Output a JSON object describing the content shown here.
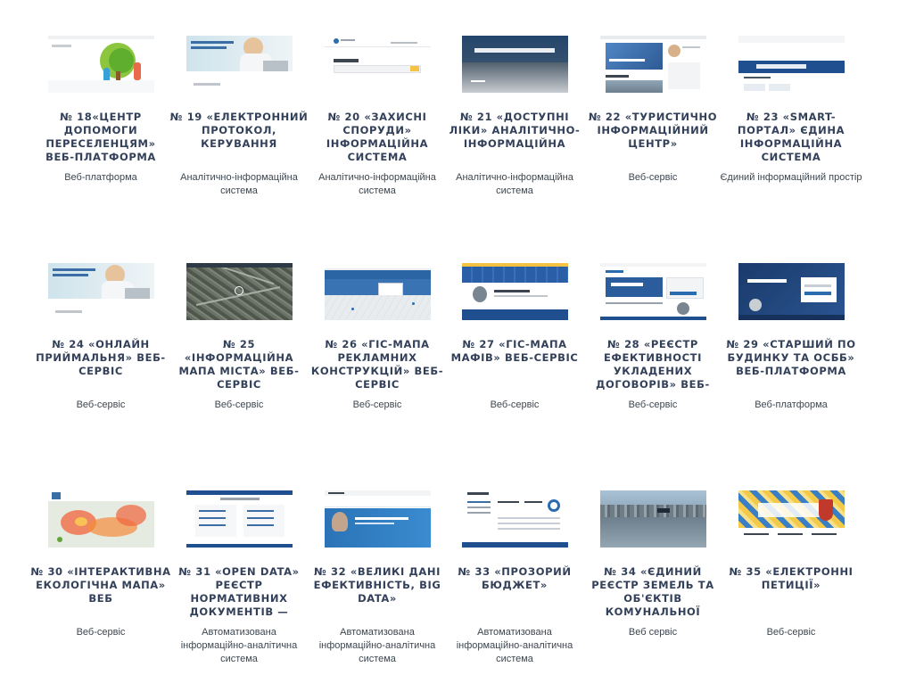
{
  "cards": [
    {
      "title": "№ 18«ЦЕНТР ДОПОМОГИ ПЕРЕСЕЛЕНЦЯМ» ВЕБ-ПЛАТФОРМА",
      "subtitle": "Веб-платформа",
      "thumb": "tree-illustration"
    },
    {
      "title": "№ 19 «ЕЛЕКТРОННИЙ ПРОТОКОЛ, КЕРУВАННЯ",
      "subtitle": "Аналітично-інформаційна система",
      "thumb": "woman-laptop"
    },
    {
      "title": "№ 20 «ЗАХИСНІ СПОРУДИ» ІНФОРМАЦІЙНА СИСТЕМА",
      "subtitle": "Аналітично-інформаційна система",
      "thumb": "search-form"
    },
    {
      "title": "№ 21 «ДОСТУПНІ ЛІКИ» АНАЛІТИЧНО-ІНФОРМАЦІЙНА",
      "subtitle": "Аналітично-інформаційна система",
      "thumb": "dark-banner"
    },
    {
      "title": "№ 22 «ТУРИСТИЧНО ІНФОРМАЦІЙНИЙ ЦЕНТР»",
      "subtitle": "Веб-сервіс",
      "thumb": "tourism-site"
    },
    {
      "title": "№ 23 «SMART-ПОРТАЛ» ЄДИНА ІНФОРМАЦІЙНА СИСТЕМА",
      "subtitle": "Єдиний інформаційний простір",
      "thumb": "smart-portal"
    },
    {
      "title": "№ 24 «ОНЛАЙН ПРИЙМАЛЬНЯ» ВЕБ-СЕРВІС",
      "subtitle": "Веб-сервіс",
      "thumb": "woman-laptop"
    },
    {
      "title": "№ 25 «ІНФОРМАЦІЙНА МАПА МІСТА» ВЕБ-СЕРВІС",
      "subtitle": "Веб-сервіс",
      "thumb": "satellite-map"
    },
    {
      "title": "№ 26 «ГІС-МАПА РЕКЛАМНИХ КОНСТРУКЦІЙ» ВЕБ-СЕРВІС",
      "subtitle": "Веб-сервіс",
      "thumb": "gis-map"
    },
    {
      "title": "№ 27 «ГІС-МАПА МАФІВ» ВЕБ-СЕРВІС",
      "subtitle": "Веб-сервіс",
      "thumb": "blue-map-profile"
    },
    {
      "title": "№ 28 «РЕЄСТР ЕФЕКТИВНОСТІ УКЛАДЕНИХ ДОГОВОРІВ» ВЕБ-",
      "subtitle": "Веб-сервіс",
      "thumb": "registry-login"
    },
    {
      "title": "№ 29 «СТАРШИЙ ПО БУДИНКУ ТА ОСББ» ВЕБ-ПЛАТФОРМА",
      "subtitle": "Веб-платформа",
      "thumb": "dark-login"
    },
    {
      "title": "№ 30 «ІНТЕРАКТИВНА ЕКОЛОГІЧНА МАПА» ВЕБ",
      "subtitle": "Веб-сервіс",
      "thumb": "heat-map"
    },
    {
      "title": "№ 31 «OPEN DATA» РЕЄСТР НОРМАТИВНИХ ДОКУМЕНТІВ —",
      "subtitle": "Автоматизована інформаційно-аналітична система",
      "thumb": "doc-list"
    },
    {
      "title": "№ 32 «ВЕЛИКІ ДАНІ ЕФЕКТИВНІСТЬ, BIG DATA»",
      "subtitle": "Автоматизована інформаційно-аналітична система",
      "thumb": "bigdata-banner"
    },
    {
      "title": "№ 33 «ПРОЗОРИЙ БЮДЖЕТ»",
      "subtitle": "Автоматизована інформаційно-аналітична система",
      "thumb": "budget-table"
    },
    {
      "title": "№ 34 «ЄДИНИЙ РЕЄСТР ЗЕМЕЛЬ ТА ОБ'ЄКТІВ КОМУНАЛЬНОЇ",
      "subtitle": "Веб сервіс",
      "thumb": "city-aerial"
    },
    {
      "title": "№ 35 «ЕЛЕКТРОННІ ПЕТИЦІЇ»",
      "subtitle": "Веб-сервіс",
      "thumb": "petitions"
    }
  ]
}
